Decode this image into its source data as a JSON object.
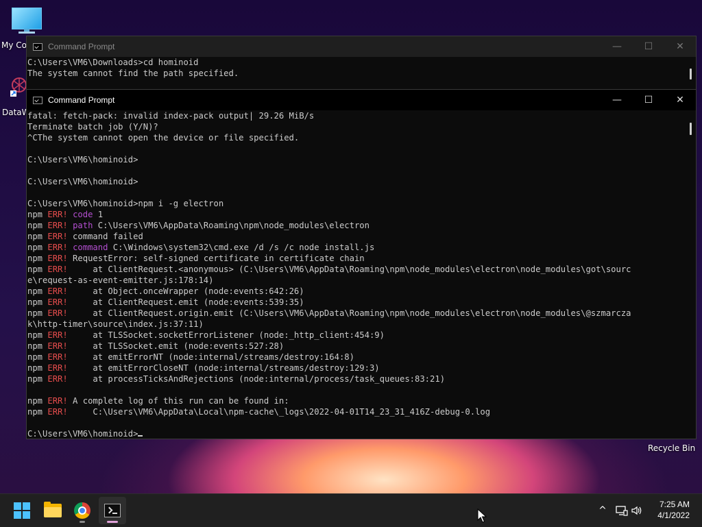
{
  "desktop": {
    "icons": [
      {
        "label": "My Co"
      },
      {
        "label": "DataW"
      },
      {
        "label": "Recycle Bin"
      }
    ]
  },
  "windows": {
    "back": {
      "title": "Command Prompt",
      "lines": [
        "C:\\Users\\VM6\\Downloads>cd hominoid",
        "The system cannot find the path specified."
      ]
    },
    "front": {
      "title": "Command Prompt",
      "lines": [
        "fatal: fetch-pack: invalid index-pack output| 29.26 MiB/s",
        "Terminate batch job (Y/N)?",
        "^CThe system cannot open the device or file specified.",
        "",
        "C:\\Users\\VM6\\hominoid>",
        "",
        "C:\\Users\\VM6\\hominoid>",
        "",
        "C:\\Users\\VM6\\hominoid>npm i -g electron"
      ],
      "npm_lines": [
        {
          "tag": "code",
          "text": " 1"
        },
        {
          "tag": "path",
          "text": " C:\\Users\\VM6\\AppData\\Roaming\\npm\\node_modules\\electron"
        },
        {
          "tag": "",
          "text": " command failed"
        },
        {
          "tag": "command",
          "text": " C:\\Windows\\system32\\cmd.exe /d /s /c node install.js"
        },
        {
          "tag": "",
          "text": " RequestError: self-signed certificate in certificate chain"
        },
        {
          "tag": "",
          "text": "     at ClientRequest.<anonymous> (C:\\Users\\VM6\\AppData\\Roaming\\npm\\node_modules\\electron\\node_modules\\got\\sourc"
        }
      ],
      "wrap1": "e\\request-as-event-emitter.js:178:14)",
      "npm_lines2": [
        "     at Object.onceWrapper (node:events:642:26)",
        "     at ClientRequest.emit (node:events:539:35)",
        "     at ClientRequest.origin.emit (C:\\Users\\VM6\\AppData\\Roaming\\npm\\node_modules\\electron\\node_modules\\@szmarcza"
      ],
      "wrap2": "k\\http-timer\\source\\index.js:37:11)",
      "npm_lines3": [
        "     at TLSSocket.socketErrorListener (node:_http_client:454:9)",
        "     at TLSSocket.emit (node:events:527:28)",
        "     at emitErrorNT (node:internal/streams/destroy:164:8)",
        "     at emitErrorCloseNT (node:internal/streams/destroy:129:3)",
        "     at processTicksAndRejections (node:internal/process/task_queues:83:21)"
      ],
      "log_line1": " A complete log of this run can be found in:",
      "log_line2": "     C:\\Users\\VM6\\AppData\\Local\\npm-cache\\_logs\\2022-04-01T14_23_31_416Z-debug-0.log",
      "prompt": "C:\\Users\\VM6\\hominoid>",
      "npm_prefix": "npm",
      "err_tag": "ERR!"
    },
    "controls": {
      "minimize": "—",
      "maximize": "☐",
      "close": "✕"
    }
  },
  "taskbar": {
    "clock_time": "7:25 AM",
    "clock_date": "4/1/2022",
    "tray": {
      "chevron": "^",
      "network": "⊡",
      "volume": "🔊"
    }
  },
  "colors": {
    "accent": "#4cc2ff",
    "npm_err": "#e84d4d",
    "npm_key": "#b44fd1"
  }
}
